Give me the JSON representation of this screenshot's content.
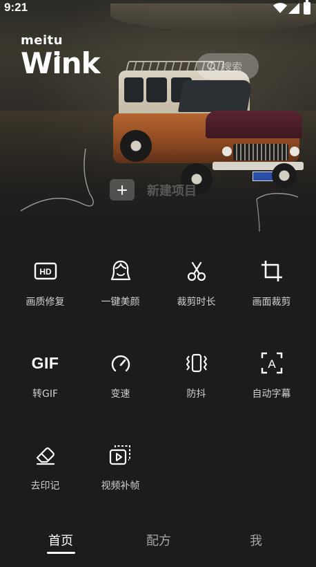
{
  "status_bar": {
    "time": "9:21",
    "icons": [
      "wifi-icon",
      "signal-icon",
      "battery-icon"
    ]
  },
  "header": {
    "brand_small": "meitu",
    "brand_big": "Wink",
    "search": {
      "placeholder": "搜索",
      "icon": "search-icon"
    }
  },
  "new_project": {
    "label": "新建项目",
    "icon": "plus-icon"
  },
  "tools": [
    {
      "label": "画质修复",
      "icon": "hd-icon"
    },
    {
      "label": "一键美颜",
      "icon": "face-icon"
    },
    {
      "label": "裁剪时长",
      "icon": "scissors-icon"
    },
    {
      "label": "画面裁剪",
      "icon": "crop-icon"
    },
    {
      "label": "转GIF",
      "icon": "gif-icon",
      "icon_text": "GIF"
    },
    {
      "label": "变速",
      "icon": "speedometer-icon"
    },
    {
      "label": "防抖",
      "icon": "stabilize-icon"
    },
    {
      "label": "自动字幕",
      "icon": "subtitle-icon",
      "icon_text": "A"
    },
    {
      "label": "去印记",
      "icon": "eraser-icon"
    },
    {
      "label": "视频补帧",
      "icon": "frame-interpolation-icon"
    }
  ],
  "bottom_nav": {
    "items": [
      {
        "label": "首页",
        "active": true
      },
      {
        "label": "配方",
        "active": false
      },
      {
        "label": "我",
        "active": false
      }
    ]
  },
  "colors": {
    "background": "#1c1c1e",
    "text_primary": "#ffffff",
    "text_secondary": "#d0d0d0",
    "nav_inactive": "#a6a6a6"
  }
}
